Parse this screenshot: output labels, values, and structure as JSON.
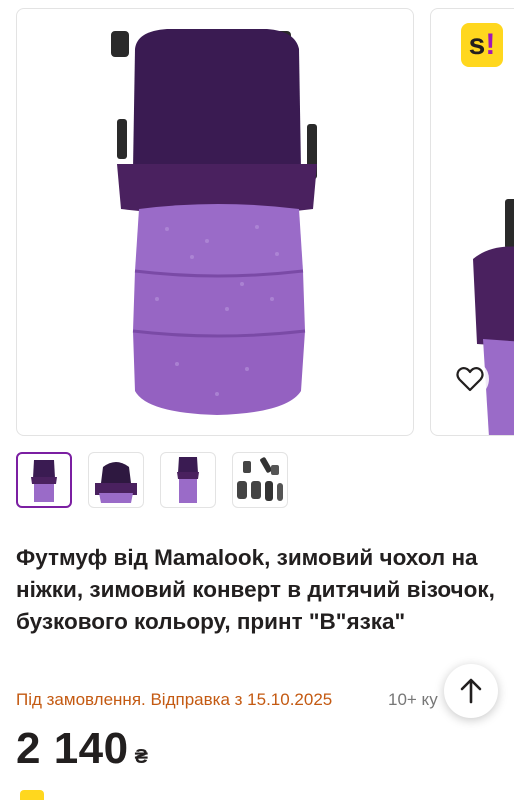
{
  "brand": {
    "logo_text": "s",
    "logo_mark": "!",
    "accent": "#a015b9",
    "logo_bg": "#ffd71e"
  },
  "gallery": {
    "favorite_icon": "heart-outline-icon",
    "thumbnail_count": 4,
    "active_thumbnail": 1
  },
  "product": {
    "title": "Футмуф від Mamalook, зимовий чохол на ніжки, зимовий конверт в дитячий візочок, бузкового кольору, принт \"В\"язка\"",
    "status": "Під замовлення. Відправка з 15.10.2025",
    "bought_count": "10+ ку",
    "price": "2 140",
    "currency": "₴"
  },
  "scroll_up_icon": "arrow-up-icon",
  "colors": {
    "status": "#c45a12",
    "text": "#221f1f",
    "muted": "#777777",
    "active_border": "#7b1fa2"
  }
}
